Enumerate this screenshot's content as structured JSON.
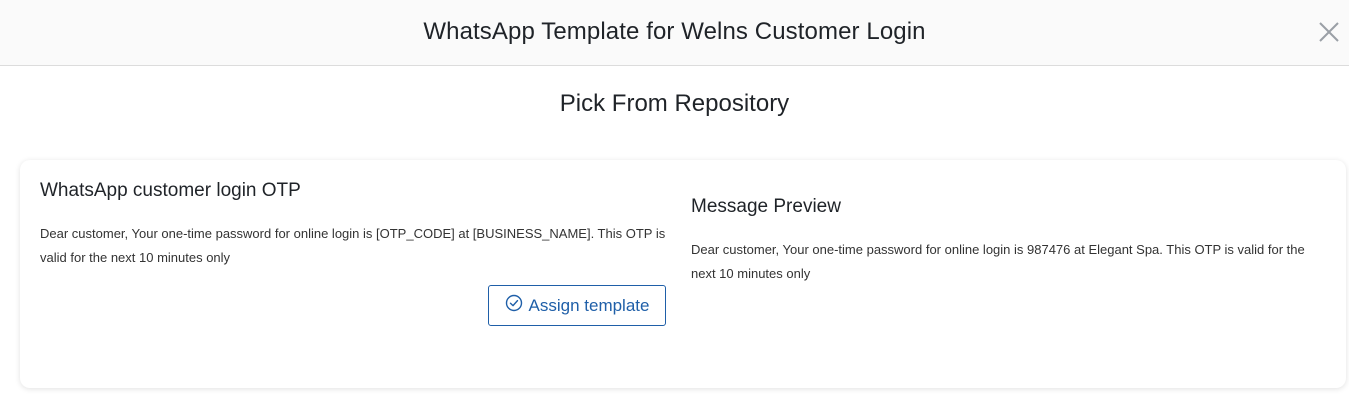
{
  "header": {
    "title": "WhatsApp Template for Welns Customer Login",
    "close_icon": "close-icon"
  },
  "section": {
    "title": "Pick From Repository"
  },
  "template": {
    "name": "WhatsApp customer login OTP",
    "body": "Dear customer, Your one-time password for online login is [OTP_CODE] at [BUSINESS_NAME]. This OTP is valid for the next 10 minutes only",
    "assign_label": "Assign template",
    "assign_icon": "check-circle-icon"
  },
  "preview": {
    "title": "Message Preview",
    "body": "Dear customer, Your one-time password for online login is 987476 at Elegant Spa. This OTP is valid for the next 10 minutes only"
  },
  "colors": {
    "accent": "#1f5fa8",
    "header_bg": "#fafafa",
    "page_bg": "#f3f4f6"
  }
}
